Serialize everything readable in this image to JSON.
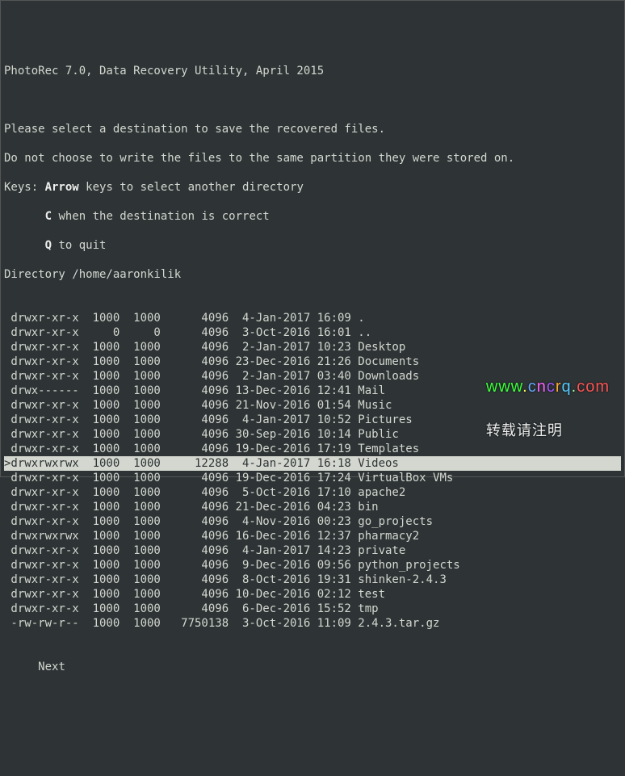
{
  "header_title": "PhotoRec 7.0, Data Recovery Utility, April 2015",
  "instructions": {
    "line1": "Please select a destination to save the recovered files.",
    "line2": "Do not choose to write the files to the same partition they were stored on.",
    "keys_prefix": "Keys: ",
    "arrow_key": "Arrow",
    "arrow_desc": " keys to select another directory",
    "c_pad": "      ",
    "c_key": "C",
    "c_desc": " when the destination is correct",
    "q_pad": "      ",
    "q_key": "Q",
    "q_desc": " to quit"
  },
  "directory_label": "Directory /home/aaronkilik",
  "rows": [
    {
      "perm": " drwxr-xr-x",
      "uid": "1000",
      "gid": "1000",
      "size": "4096",
      "date": " 4-Jan-2017",
      "time": "16:09",
      "name": ".",
      "selected": false
    },
    {
      "perm": " drwxr-xr-x",
      "uid": "0",
      "gid": "0",
      "size": "4096",
      "date": " 3-Oct-2016",
      "time": "16:01",
      "name": "..",
      "selected": false
    },
    {
      "perm": " drwxr-xr-x",
      "uid": "1000",
      "gid": "1000",
      "size": "4096",
      "date": " 2-Jan-2017",
      "time": "10:23",
      "name": "Desktop",
      "selected": false
    },
    {
      "perm": " drwxr-xr-x",
      "uid": "1000",
      "gid": "1000",
      "size": "4096",
      "date": "23-Dec-2016",
      "time": "21:26",
      "name": "Documents",
      "selected": false
    },
    {
      "perm": " drwxr-xr-x",
      "uid": "1000",
      "gid": "1000",
      "size": "4096",
      "date": " 2-Jan-2017",
      "time": "03:40",
      "name": "Downloads",
      "selected": false
    },
    {
      "perm": " drwx------",
      "uid": "1000",
      "gid": "1000",
      "size": "4096",
      "date": "13-Dec-2016",
      "time": "12:41",
      "name": "Mail",
      "selected": false
    },
    {
      "perm": " drwxr-xr-x",
      "uid": "1000",
      "gid": "1000",
      "size": "4096",
      "date": "21-Nov-2016",
      "time": "01:54",
      "name": "Music",
      "selected": false
    },
    {
      "perm": " drwxr-xr-x",
      "uid": "1000",
      "gid": "1000",
      "size": "4096",
      "date": " 4-Jan-2017",
      "time": "10:52",
      "name": "Pictures",
      "selected": false
    },
    {
      "perm": " drwxr-xr-x",
      "uid": "1000",
      "gid": "1000",
      "size": "4096",
      "date": "30-Sep-2016",
      "time": "10:14",
      "name": "Public",
      "selected": false
    },
    {
      "perm": " drwxr-xr-x",
      "uid": "1000",
      "gid": "1000",
      "size": "4096",
      "date": "19-Dec-2016",
      "time": "17:19",
      "name": "Templates",
      "selected": false
    },
    {
      "perm": ">drwxrwxrwx",
      "uid": "1000",
      "gid": "1000",
      "size": "12288",
      "date": " 4-Jan-2017",
      "time": "16:18",
      "name": "Videos",
      "selected": true
    },
    {
      "perm": " drwxr-xr-x",
      "uid": "1000",
      "gid": "1000",
      "size": "4096",
      "date": "19-Dec-2016",
      "time": "17:24",
      "name": "VirtualBox VMs",
      "selected": false
    },
    {
      "perm": " drwxr-xr-x",
      "uid": "1000",
      "gid": "1000",
      "size": "4096",
      "date": " 5-Oct-2016",
      "time": "17:10",
      "name": "apache2",
      "selected": false
    },
    {
      "perm": " drwxr-xr-x",
      "uid": "1000",
      "gid": "1000",
      "size": "4096",
      "date": "21-Dec-2016",
      "time": "04:23",
      "name": "bin",
      "selected": false
    },
    {
      "perm": " drwxr-xr-x",
      "uid": "1000",
      "gid": "1000",
      "size": "4096",
      "date": " 4-Nov-2016",
      "time": "00:23",
      "name": "go_projects",
      "selected": false
    },
    {
      "perm": " drwxrwxrwx",
      "uid": "1000",
      "gid": "1000",
      "size": "4096",
      "date": "16-Dec-2016",
      "time": "12:37",
      "name": "pharmacy2",
      "selected": false
    },
    {
      "perm": " drwxr-xr-x",
      "uid": "1000",
      "gid": "1000",
      "size": "4096",
      "date": " 4-Jan-2017",
      "time": "14:23",
      "name": "private",
      "selected": false
    },
    {
      "perm": " drwxr-xr-x",
      "uid": "1000",
      "gid": "1000",
      "size": "4096",
      "date": " 9-Dec-2016",
      "time": "09:56",
      "name": "python_projects",
      "selected": false
    },
    {
      "perm": " drwxr-xr-x",
      "uid": "1000",
      "gid": "1000",
      "size": "4096",
      "date": " 8-Oct-2016",
      "time": "19:31",
      "name": "shinken-2.4.3",
      "selected": false
    },
    {
      "perm": " drwxr-xr-x",
      "uid": "1000",
      "gid": "1000",
      "size": "4096",
      "date": "10-Dec-2016",
      "time": "02:12",
      "name": "test",
      "selected": false
    },
    {
      "perm": " drwxr-xr-x",
      "uid": "1000",
      "gid": "1000",
      "size": "4096",
      "date": " 6-Dec-2016",
      "time": "15:52",
      "name": "tmp",
      "selected": false
    },
    {
      "perm": " -rw-rw-r--",
      "uid": "1000",
      "gid": "1000",
      "size": "7750138",
      "date": " 3-Oct-2016",
      "time": "11:09",
      "name": "2.4.3.tar.gz",
      "selected": false
    }
  ],
  "menu": {
    "next": "Next"
  },
  "watermark": {
    "line1": "www.cncrq.com",
    "line2": "转载请注明"
  }
}
